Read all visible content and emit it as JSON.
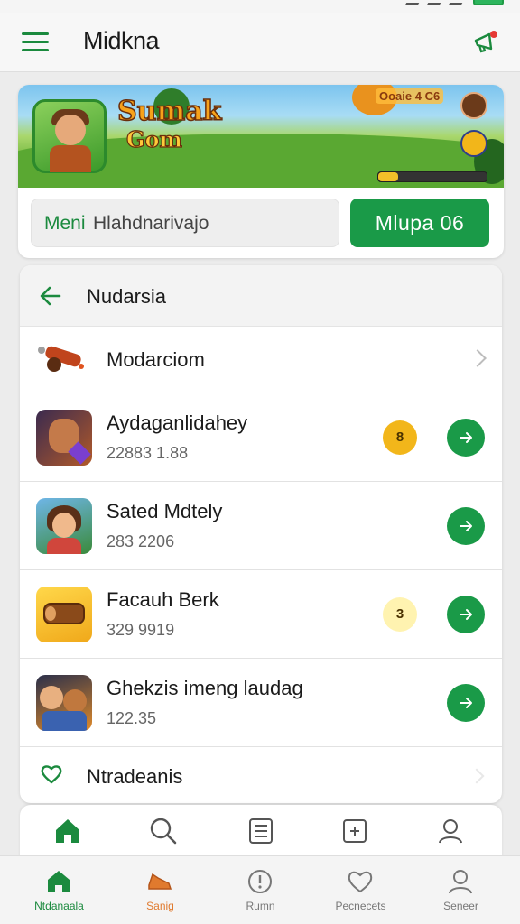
{
  "header": {
    "title": "Midkna"
  },
  "banner": {
    "logo_line1": "Sumak",
    "logo_line2": "Gom",
    "score": "Ooaie 4 C6",
    "progress": 0.18
  },
  "search": {
    "label": "Meni",
    "placeholder": "Hlahdnarivajo",
    "action_label": "Mlupa 06"
  },
  "list": {
    "title": "Nudarsia",
    "featured": {
      "name": "Modarciom",
      "icon": "cannon-icon"
    },
    "items": [
      {
        "name": "Aydaganlidahey",
        "sub": "22883 1.88",
        "badge": "8",
        "badge_color": "#f2b61a",
        "icon": "warrior-game-icon"
      },
      {
        "name": "Sated Mdtely",
        "sub": "283 2206",
        "icon": "girl-game-icon"
      },
      {
        "name": "Facauh Berk",
        "sub": "329 9919",
        "badge": "3",
        "badge_color": "#fff3b0",
        "icon": "log-game-icon"
      },
      {
        "name": "Ghekzis imeng laudag",
        "sub": "122.35",
        "icon": "party-game-icon"
      }
    ],
    "footer_label": "Ntradeanis"
  },
  "toolbar": {
    "icons": [
      "home-icon",
      "search-icon",
      "list-icon",
      "add-box-icon",
      "profile-icon"
    ]
  },
  "bottom_nav": [
    {
      "label": "Ntdanaala",
      "icon": "home-icon",
      "color": "#1b8a3e"
    },
    {
      "label": "Sanig",
      "icon": "sneaker-icon",
      "color": "#e07a2e"
    },
    {
      "label": "Rumn",
      "icon": "info-icon",
      "color": "#777777"
    },
    {
      "label": "Pecnecets",
      "icon": "heart-icon",
      "color": "#777777"
    },
    {
      "label": "Seneer",
      "icon": "user-icon",
      "color": "#777777"
    }
  ],
  "colors": {
    "accent": "#1a9a48",
    "badge_yellow": "#f2b61a",
    "orange": "#e07a2e"
  }
}
